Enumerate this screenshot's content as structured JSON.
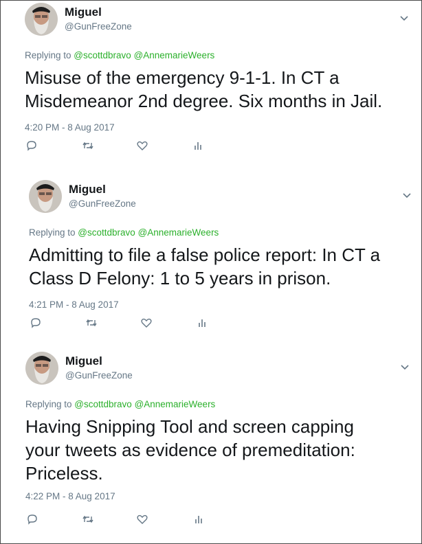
{
  "colors": {
    "mention": "#2bb02b",
    "meta": "#657786",
    "text": "#14171a"
  },
  "tweets": [
    {
      "name": "Miguel",
      "handle": "@GunFreeZone",
      "reply_prefix": "Replying to ",
      "mention_1": "@scottdbravo",
      "mention_2": "@AnnemarieWeers",
      "text": "Misuse of the emergency 9-1-1. In CT a\nMisdemeanor 2nd degree. Six months in Jail.",
      "time": "4:20 PM - 8 Aug 2017"
    },
    {
      "name": "Miguel",
      "handle": "@GunFreeZone",
      "reply_prefix": "Replying to ",
      "mention_1": "@scottdbravo",
      "mention_2": "@AnnemarieWeers",
      "text": "Admitting to file a false police report: In CT a\nClass D Felony: 1 to 5 years in prison.",
      "time": "4:21 PM - 8 Aug 2017"
    },
    {
      "name": "Miguel",
      "handle": "@GunFreeZone",
      "reply_prefix": "Replying to ",
      "mention_1": "@scottdbravo",
      "mention_2": "@AnnemarieWeers",
      "text": "Having Snipping Tool and screen capping\nyour tweets as evidence of premeditation:\nPriceless.",
      "time": "4:22 PM - 8 Aug 2017"
    }
  ],
  "icons": [
    "avatar",
    "chevron-down-icon",
    "reply-icon",
    "retweet-icon",
    "like-icon",
    "analytics-icon"
  ]
}
